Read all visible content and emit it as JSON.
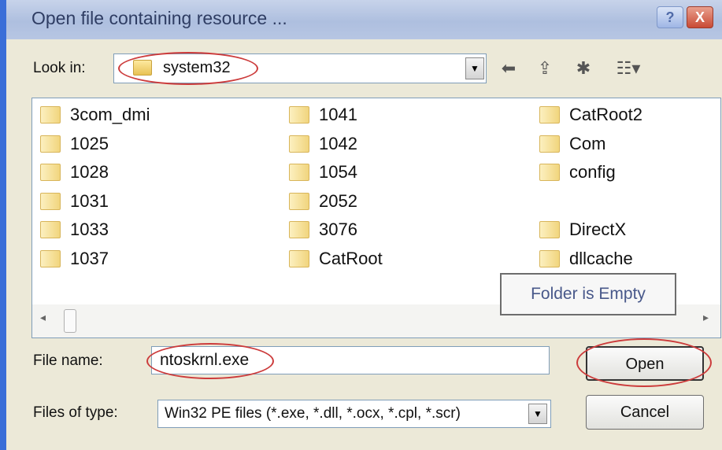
{
  "window": {
    "title": "Open file containing resource ...",
    "help_glyph": "?",
    "close_glyph": "X"
  },
  "lookin": {
    "label": "Look in:",
    "value": "system32",
    "dropdown_glyph": "▼"
  },
  "toolbar": {
    "back_glyph": "⬅",
    "up_glyph": "⇪",
    "newfolder_glyph": "✱",
    "view_glyph": "☷▾"
  },
  "files": [
    [
      "3com_dmi",
      "1025",
      "1028",
      "1031",
      "1033",
      "1037"
    ],
    [
      "1041",
      "1042",
      "1054",
      "2052",
      "3076",
      "CatRoot"
    ],
    [
      "CatRoot2",
      "Com",
      "config",
      "",
      "DirectX",
      "dllcache"
    ]
  ],
  "tooltip": "Folder is Empty",
  "scroll": {
    "left_glyph": "◂",
    "right_glyph": "▸"
  },
  "filename": {
    "label": "File name:",
    "value": "ntoskrnl.exe"
  },
  "filetype": {
    "label": "Files of type:",
    "value": "Win32 PE files (*.exe, *.dll, *.ocx, *.cpl, *.scr)",
    "dropdown_glyph": "▼"
  },
  "buttons": {
    "open": "Open",
    "cancel": "Cancel"
  },
  "annotation_color": "#cc3b3b"
}
